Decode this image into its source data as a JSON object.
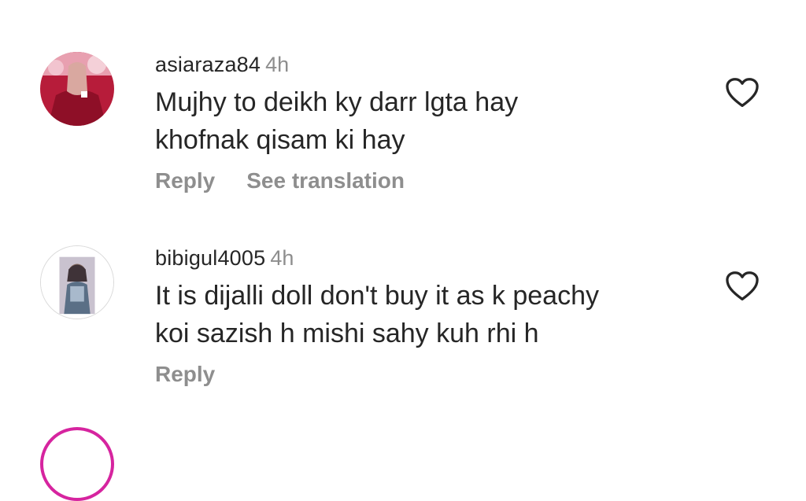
{
  "comments": [
    {
      "username": "asiaraza84",
      "time": "4h",
      "lines": [
        "Mujhy to deikh ky darr lgta hay",
        "khofnak qisam ki hay"
      ],
      "reply_label": "Reply",
      "translation_label": "See translation",
      "icon": "heart-outline-icon"
    },
    {
      "username": "bibigul4005",
      "time": "4h",
      "lines": [
        "It is dijalli doll don't buy it as k peachy",
        "koi sazish h mishi sahy kuh rhi h"
      ],
      "reply_label": "Reply",
      "icon": "heart-outline-icon"
    }
  ],
  "colors": {
    "text": "#262626",
    "muted": "#8e8e8e",
    "story_ring": "#d6249f"
  }
}
